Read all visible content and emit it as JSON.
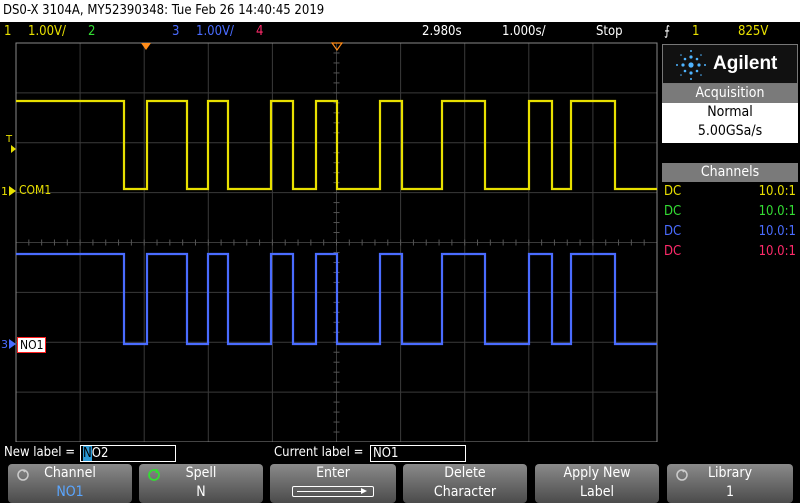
{
  "title_bar": {
    "text": "DS0-X 3104A, MY52390348: Tue Feb 26 14:40:45 2019"
  },
  "status_bar": {
    "ch1_num": "1",
    "ch1_scale": "1.00V/",
    "ch2_num": "2",
    "ch3_num": "3",
    "ch3_scale": "1.00V/",
    "ch4_num": "4",
    "time_delay": "2.980s",
    "time_scale": "1.000s/",
    "run_state": "Stop",
    "trigger_icon": "trigger-edge-icon",
    "trigger_source": "1",
    "trigger_level": "825V"
  },
  "screen": {
    "ch1_label": "COM1",
    "ch3_label": "NO1",
    "ch1_marker": "1",
    "ch3_marker": "3",
    "trigger_marker": "T"
  },
  "side_panel": {
    "brand": "Agilent",
    "acquisition_title": "Acquisition",
    "acq_mode": "Normal",
    "acq_rate": "5.00GSa/s",
    "channels_title": "Channels",
    "channels": [
      {
        "coupling": "DC",
        "probe": "10.0:1",
        "color": "#e8e000"
      },
      {
        "coupling": "DC",
        "probe": "10.0:1",
        "color": "#33dd33"
      },
      {
        "coupling": "DC",
        "probe": "10.0:1",
        "color": "#4a6cff"
      },
      {
        "coupling": "DC",
        "probe": "10.0:1",
        "color": "#ff2a6a"
      }
    ]
  },
  "label_edit": {
    "new_label_caption": "New label =",
    "new_label_first": "N",
    "new_label_rest": "O2",
    "current_label_caption": "Current label =",
    "current_label_value": "NO1"
  },
  "softkeys": [
    {
      "line1": "Channel",
      "line2": "NO1"
    },
    {
      "line1": "Spell",
      "line2": "N"
    },
    {
      "line1": "Enter",
      "line2": ""
    },
    {
      "line1": "Delete",
      "line2": "Character"
    },
    {
      "line1": "Apply New",
      "line2": "Label"
    },
    {
      "line1": "Library",
      "line2": "1"
    }
  ],
  "colors": {
    "ch1": "#e8e000",
    "ch2": "#33dd33",
    "ch3": "#4a6cff",
    "ch4": "#ff2a6a",
    "trigger_orange": "#ff8c1a"
  },
  "waveforms": {
    "ch1_high_segments": [
      [
        0,
        124
      ],
      [
        147,
        187
      ],
      [
        208,
        228
      ],
      [
        271,
        293
      ],
      [
        316,
        337
      ],
      [
        380,
        402
      ],
      [
        442,
        485
      ],
      [
        529,
        552
      ],
      [
        571,
        615
      ]
    ],
    "ch3_high_segments": [
      [
        0,
        124
      ],
      [
        147,
        187
      ],
      [
        208,
        228
      ],
      [
        271,
        293
      ],
      [
        316,
        337
      ],
      [
        380,
        402
      ],
      [
        442,
        485
      ],
      [
        529,
        552
      ],
      [
        571,
        615
      ]
    ]
  }
}
